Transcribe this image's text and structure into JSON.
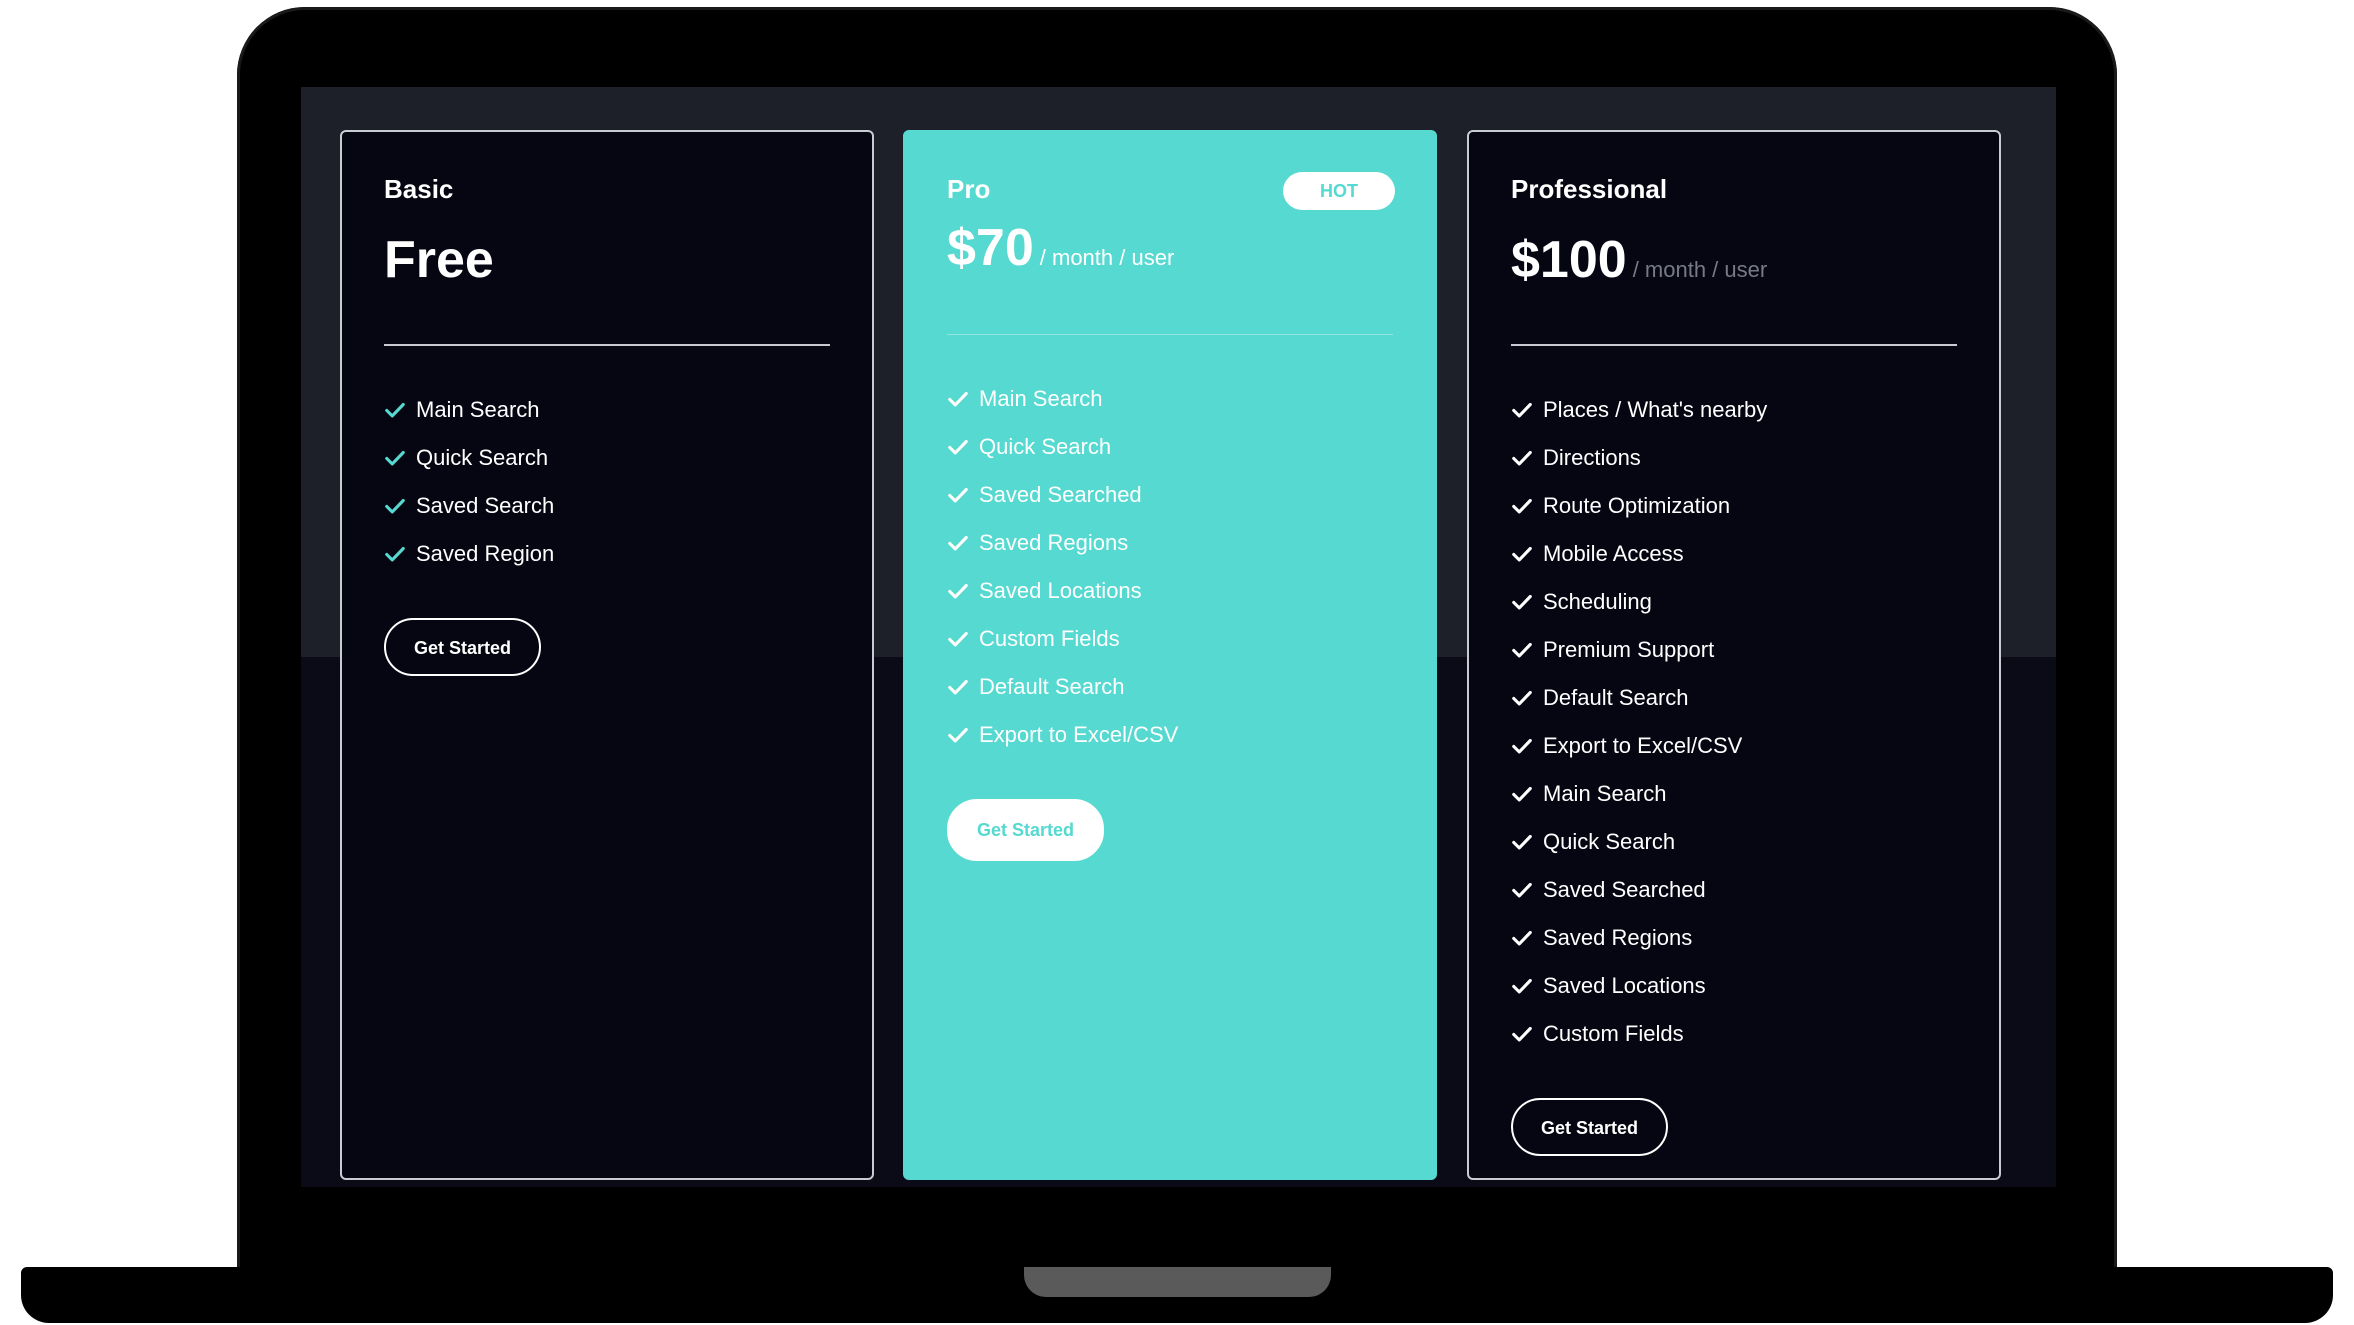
{
  "plans": [
    {
      "name": "Basic",
      "price": "Free",
      "period": "",
      "features": [
        "Main Search",
        "Quick Search",
        "Saved Search",
        "Saved Region"
      ],
      "cta": "Get Started"
    },
    {
      "name": "Pro",
      "badge": "HOT",
      "price": "$70",
      "period": "/ month / user",
      "features": [
        "Main Search",
        "Quick Search",
        "Saved Searched",
        "Saved Regions",
        "Saved Locations",
        "Custom Fields",
        "Default Search",
        "Export to Excel/CSV"
      ],
      "cta": "Get Started"
    },
    {
      "name": "Professional",
      "price": "$100",
      "period": "/ month / user",
      "features": [
        "Places / What's nearby",
        "Directions",
        "Route Optimization",
        "Mobile Access",
        "Scheduling",
        "Premium Support",
        "Default Search",
        "Export to Excel/CSV",
        "Main Search",
        "Quick Search",
        "Saved Searched",
        "Saved Regions",
        "Saved Locations",
        "Custom Fields"
      ],
      "cta": "Get Started"
    }
  ],
  "colors": {
    "accent": "#55d9d0",
    "card_dark": "#060612",
    "screen_top": "#1d2029",
    "screen_bottom": "#0b0b17"
  },
  "icons": {
    "feature": "check-icon"
  }
}
